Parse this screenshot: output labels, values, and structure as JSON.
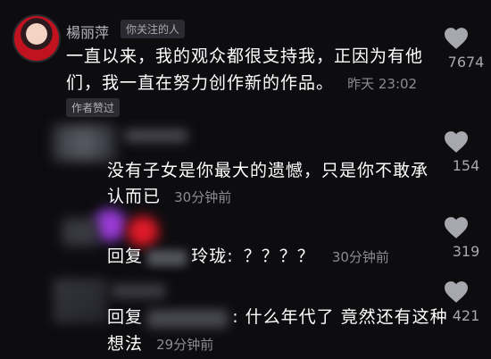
{
  "main_comment": {
    "username": "楊丽萍",
    "badge": "你关注的人",
    "line1": "一直以来，我的观众都很支持我，正因为有他",
    "line2": "们，我一直在努力创作新的作品。",
    "time": "昨天 23:02",
    "likes": "7674",
    "author_liked": "作者赞过"
  },
  "replies": [
    {
      "line1": "没有子女是你最大的遗憾，只是你不敢承",
      "line2": "认而已",
      "time": "30分钟前",
      "likes": "154"
    },
    {
      "prefix": "回复",
      "name_partial": "玲珑:",
      "text": "？？？？",
      "time": "30分钟前",
      "likes": "319"
    },
    {
      "prefix": "回复",
      "text": ":  什么年代了 竟然还有这种",
      "line2": "想法",
      "time": "29分钟前",
      "likes": "421"
    }
  ],
  "colors": {
    "background": "#0d0d10",
    "heart": "#a7a7ae"
  },
  "icons": [
    "heart-icon"
  ]
}
